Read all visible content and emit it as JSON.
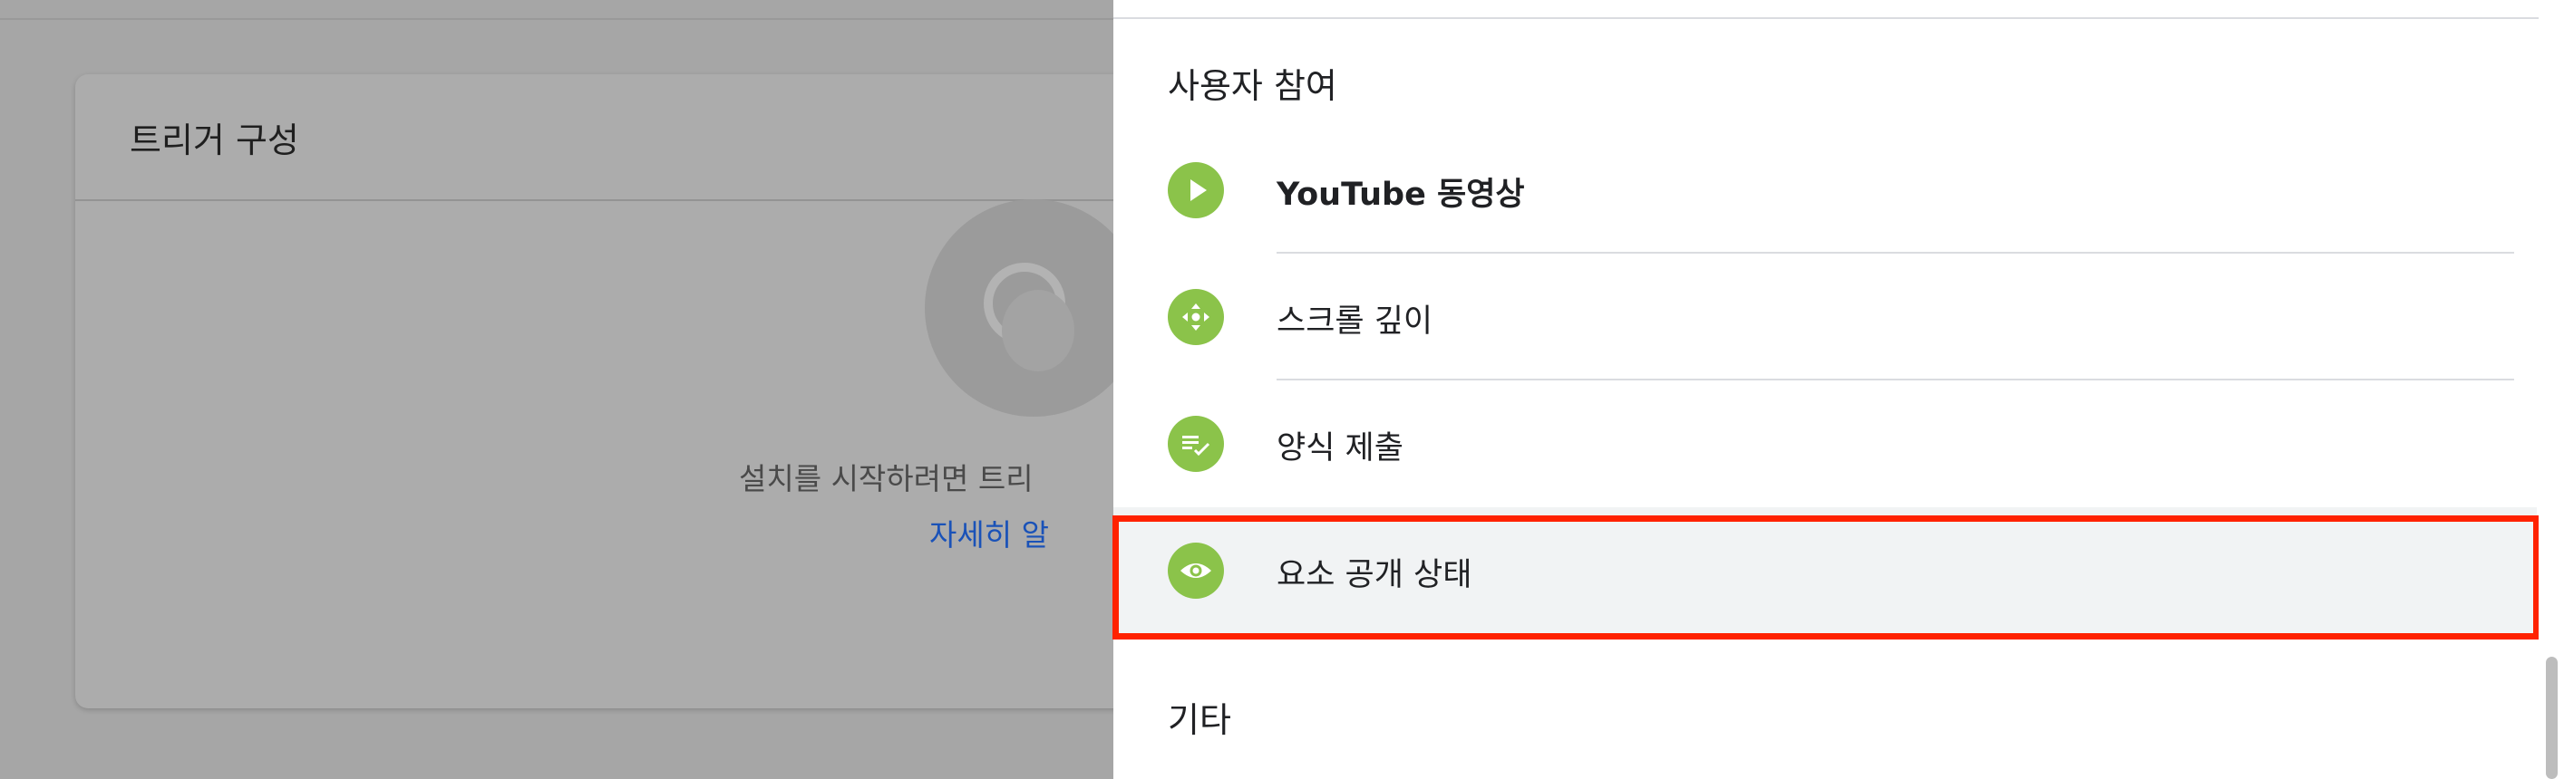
{
  "background": {
    "card_title": "트리거 구성",
    "description": "설치를 시작하려면 트리",
    "link": "자세히 알"
  },
  "panel": {
    "sections": [
      {
        "title": "사용자 참여",
        "items": [
          {
            "label": "YouTube 동영상",
            "icon": "play-icon",
            "bold": true
          },
          {
            "label": "스크롤 깊이",
            "icon": "move-arrows-icon"
          },
          {
            "label": "양식 제출",
            "icon": "checklist-icon"
          },
          {
            "label": "요소 공개 상태",
            "icon": "eye-icon",
            "selected": true
          }
        ]
      },
      {
        "title": "기타"
      }
    ]
  },
  "colors": {
    "icon_green": "#8bc34a",
    "highlight": "#ff2200",
    "link_blue": "#1a52b8"
  }
}
